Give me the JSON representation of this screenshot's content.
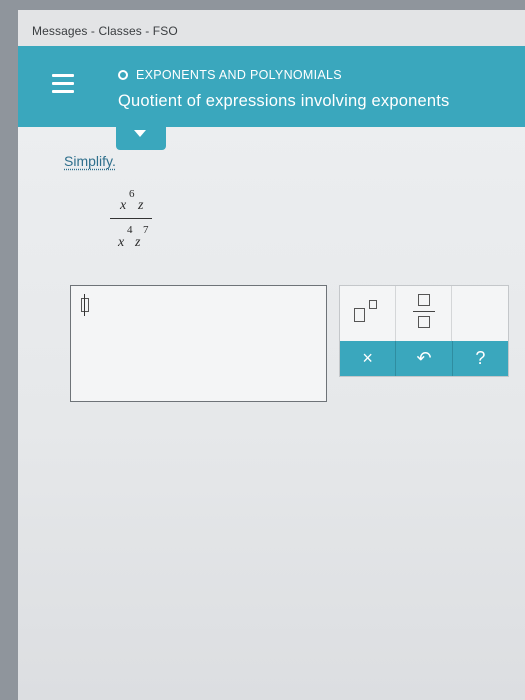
{
  "browser": {
    "tab_title": "Messages - Classes - FSO"
  },
  "header": {
    "section": "EXPONENTS AND POLYNOMIALS",
    "title": "Quotient of expressions involving exponents"
  },
  "problem": {
    "instruction": "Simplify.",
    "numerator": {
      "x_base": "x",
      "x_exp": "6",
      "z_base": "z"
    },
    "denominator": {
      "x_base": "x",
      "x_exp": "4",
      "z_base": "z",
      "z_exp": "7"
    }
  },
  "keypad": {
    "clear_label": "×",
    "undo_label": "↶",
    "help_label": "?"
  },
  "colors": {
    "accent": "#3aa7bd",
    "link": "#2e6f8c"
  },
  "icons": [
    "menu-icon",
    "circle-icon",
    "chevron-down-icon",
    "exponent-icon",
    "fraction-icon"
  ]
}
